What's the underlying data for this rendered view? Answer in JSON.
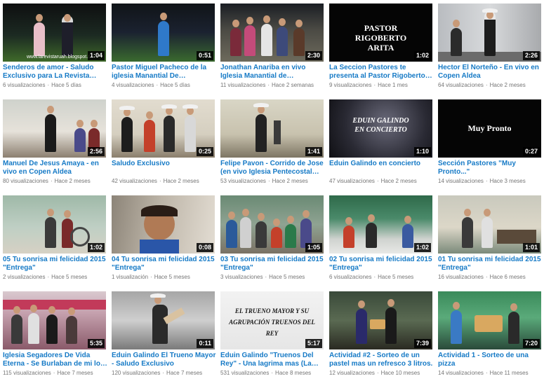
{
  "colors": {
    "title_link": "#167ac6",
    "meta_text": "#767676",
    "duration_bg": "#000000"
  },
  "videos": [
    {
      "title": "Senderos de amor - Saludo Exclusivo para La Revista Ruah",
      "duration": "1:04",
      "views": "6 visualizaciones",
      "age": "Hace 5 días",
      "overlay": "www.larevistaruah.blogspot.c"
    },
    {
      "title": "Pastor Miguel Pacheco de la iglesia Manantial De Avivamiento...",
      "duration": "0:51",
      "views": "4 visualizaciones",
      "age": "Hace 5 días",
      "overlay": ""
    },
    {
      "title": "Jonathan Anariba en vivo Iglesia Manantial de Avivamiento Cope...",
      "duration": "2:30",
      "views": "11 visualizaciones",
      "age": "Hace 2 semanas",
      "overlay": ""
    },
    {
      "title": "La Seccion Pastores te presenta al Pastor Rigoberto Arita.",
      "duration": "1:02",
      "views": "9 visualizaciones",
      "age": "Hace 1 mes",
      "overlay": "PASTOR RIGOBERTO ARITA"
    },
    {
      "title": "Hector El Norteño - En vivo en Copen Aldea",
      "duration": "2:26",
      "views": "64 visualizaciones",
      "age": "Hace 2 meses",
      "overlay": ""
    },
    {
      "title": "Manuel De Jesus Amaya - en vivo en Copen Aldea",
      "duration": "2:56",
      "views": "80 visualizaciones",
      "age": "Hace 2 meses",
      "overlay": ""
    },
    {
      "title": "Saludo Exclusivo",
      "duration": "0:25",
      "views": "42 visualizaciones",
      "age": "Hace 2 meses",
      "overlay": ""
    },
    {
      "title": "Felipe Pavon - Corrido de Jose (en vivo Iglesia Pentecostal Las...",
      "duration": "1:41",
      "views": "53 visualizaciones",
      "age": "Hace 2 meses",
      "overlay": ""
    },
    {
      "title": "Eduin Galindo en concierto",
      "duration": "1:10",
      "views": "47 visualizaciones",
      "age": "Hace 2 meses",
      "overlay": "EDUIN GALINDO EN CONCIERTO"
    },
    {
      "title": "Sección Pastores \"Muy Pronto...\"",
      "duration": "0:27",
      "views": "14 visualizaciones",
      "age": "Hace 3 meses",
      "overlay": "Muy Pronto"
    },
    {
      "title": "05 Tu sonrisa mi felicidad 2015 \"Entrega\"",
      "duration": "1:02",
      "views": "2 visualizaciones",
      "age": "Hace 5 meses",
      "overlay": ""
    },
    {
      "title": "04 Tu sonrisa mi felicidad 2015 \"Entrega\"",
      "duration": "0:08",
      "views": "1 visualización",
      "age": "Hace 5 meses",
      "overlay": ""
    },
    {
      "title": "03 Tu sonrisa mi felicidad 2015 \"Entrega\"",
      "duration": "1:05",
      "views": "3 visualizaciones",
      "age": "Hace 5 meses",
      "overlay": ""
    },
    {
      "title": "02 Tu sonrisa mi felicidad 2015 \"Entrega\"",
      "duration": "1:02",
      "views": "6 visualizaciones",
      "age": "Hace 5 meses",
      "overlay": ""
    },
    {
      "title": "01 Tu sonrisa mi felicidad 2015 \"Entrega\"",
      "duration": "1:01",
      "views": "16 visualizaciones",
      "age": "Hace 6 meses",
      "overlay": ""
    },
    {
      "title": "Iglesia Segadores De Vida Eterna - Se Burlaban de mi los enemigo...",
      "duration": "5:35",
      "views": "115 visualizaciones",
      "age": "Hace 7 meses",
      "overlay": ""
    },
    {
      "title": "Eduin Galindo El Trueno Mayor - Saludo Exclusivo",
      "duration": "0:11",
      "views": "120 visualizaciones",
      "age": "Hace 7 meses",
      "overlay": ""
    },
    {
      "title": "Eduin Galindo \"Truenos Del Rey\" - Una lagrima mas (La Revista...",
      "duration": "5:17",
      "views": "531 visualizaciones",
      "age": "Hace 8 meses",
      "overlay": "EL TRUENO MAYOR Y SU AGRUPACIÓN TRUENOS DEL REY"
    },
    {
      "title": "Actividad #2 - Sorteo de un pastel mas un refresco 3 litros.",
      "duration": "7:39",
      "views": "12 visualizaciones",
      "age": "Hace 10 meses",
      "overlay": ""
    },
    {
      "title": "Actividad 1 - Sorteo de una pizza",
      "duration": "7:20",
      "views": "14 visualizaciones",
      "age": "Hace 11 meses",
      "overlay": ""
    }
  ]
}
